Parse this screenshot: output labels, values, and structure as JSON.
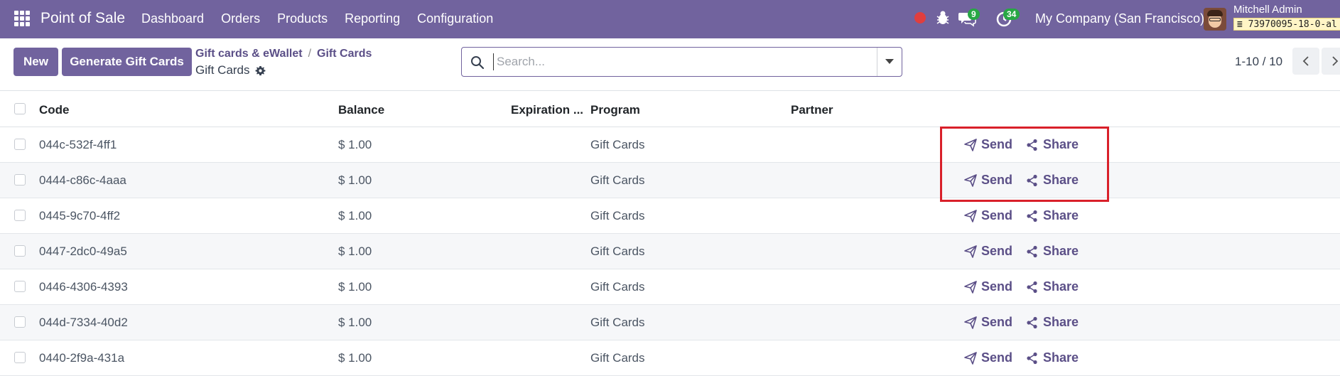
{
  "navbar": {
    "app_title": "Point of Sale",
    "menu": [
      "Dashboard",
      "Orders",
      "Products",
      "Reporting",
      "Configuration"
    ],
    "chat_count": "9",
    "activity_count": "34",
    "company": "My Company (San Francisco)",
    "user_name": "Mitchell Admin",
    "db_name": "73970095-18-0-al",
    "colors": {
      "navbar": "#71639e",
      "badge": "#28a745",
      "record": "#e03e3e"
    }
  },
  "control": {
    "new_label": "New",
    "generate_label": "Generate Gift Cards",
    "breadcrumb": [
      "Gift cards & eWallet",
      "Gift Cards"
    ],
    "page_title": "Gift Cards",
    "search_placeholder": "Search...",
    "pager": "1-10 / 10"
  },
  "table": {
    "columns": {
      "code": "Code",
      "balance": "Balance",
      "expiration": "Expiration ...",
      "program": "Program",
      "partner": "Partner"
    },
    "send_label": "Send",
    "share_label": "Share",
    "rows": [
      {
        "code": "044c-532f-4ff1",
        "balance": "$ 1.00",
        "program": "Gift Cards"
      },
      {
        "code": "0444-c86c-4aaa",
        "balance": "$ 1.00",
        "program": "Gift Cards"
      },
      {
        "code": "0445-9c70-4ff2",
        "balance": "$ 1.00",
        "program": "Gift Cards"
      },
      {
        "code": "0447-2dc0-49a5",
        "balance": "$ 1.00",
        "program": "Gift Cards"
      },
      {
        "code": "0446-4306-4393",
        "balance": "$ 1.00",
        "program": "Gift Cards"
      },
      {
        "code": "044d-7334-40d2",
        "balance": "$ 1.00",
        "program": "Gift Cards"
      },
      {
        "code": "0440-2f9a-431a",
        "balance": "$ 1.00",
        "program": "Gift Cards"
      }
    ]
  }
}
